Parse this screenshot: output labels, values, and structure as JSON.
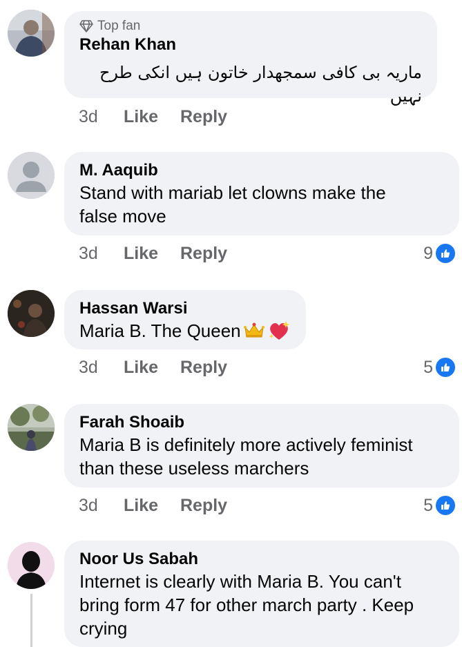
{
  "comments": [
    {
      "badge": "Top fan",
      "name": "Rehan Khan",
      "text": "ماریہ بی کافی سمجھدار خاتون ہیں انکی طرح نہیں",
      "time": "3d",
      "like": "Like",
      "reply": "Reply",
      "reactions": ""
    },
    {
      "name": "M. Aaquib",
      "text_lines": [
        "Stand with mariab let clowns make the",
        "false move"
      ],
      "time": "3d",
      "like": "Like",
      "reply": "Reply",
      "reactions": "9"
    },
    {
      "name": "Hassan Warsi",
      "text": "Maria B. The Queen",
      "emojis": [
        "crown-emoji",
        "sparkling-heart-emoji"
      ],
      "time": "3d",
      "like": "Like",
      "reply": "Reply",
      "reactions": "5"
    },
    {
      "name": "Farah Shoaib",
      "text_lines": [
        "Maria B is definitely more actively feminist",
        "than these useless marchers"
      ],
      "time": "3d",
      "like": "Like",
      "reply": "Reply",
      "reactions": "5"
    },
    {
      "name": "Noor Us Sabah",
      "text_lines": [
        "Internet is clearly with Maria B. You can't",
        "bring form 47 for other march party . Keep",
        "crying"
      ]
    }
  ],
  "colors": {
    "bubble": "#f0f2f5",
    "secondary_text": "#65676b",
    "like_blue": "#1877f2"
  }
}
